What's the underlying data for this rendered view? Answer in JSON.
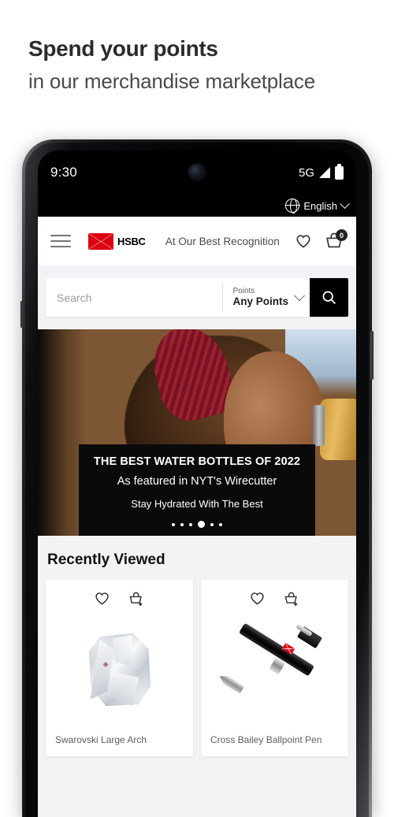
{
  "promo": {
    "title": "Spend your points",
    "subtitle": "in our merchandise marketplace"
  },
  "phone": {
    "statusbar": {
      "time": "9:30",
      "network": "5G",
      "signal_icon": "signal-bars-icon",
      "battery_icon": "battery-full-icon",
      "camera_icon": "front-camera-punch-hole"
    },
    "language_bar": {
      "globe_icon": "globe-icon",
      "label": "English",
      "chevron_icon": "chevron-down-icon"
    }
  },
  "navbar": {
    "menu_icon": "hamburger-menu-icon",
    "logo_text": "HSBC",
    "logo_icon": "hsbc-hexagon-logo",
    "brand_color": "#db0011",
    "title": "At Our Best Recognition",
    "wishlist_icon": "heart-icon",
    "cart_icon": "basket-icon",
    "cart_count": "0"
  },
  "search": {
    "placeholder": "Search",
    "value": "",
    "filter_label": "Points",
    "filter_value": "Any Points",
    "filter_chevron_icon": "chevron-down-icon",
    "submit_icon": "search-icon"
  },
  "hero": {
    "image_alt": "woman-drinking-from-water-bottle",
    "headline": "THE BEST WATER BOTTLES OF 2022",
    "subhead": "As featured in NYT's Wirecutter",
    "tagline": "Stay Hydrated With The Best",
    "carousel": {
      "total": 6,
      "active_index": 3
    }
  },
  "recently_viewed": {
    "title": "Recently Viewed",
    "products": [
      {
        "name": "Swarovski Large Arch",
        "image_alt": "crystal-arch-award",
        "wishlist_icon": "heart-icon",
        "add_icon": "add-to-basket-icon"
      },
      {
        "name": "Cross Bailey Ballpoint Pen",
        "image_alt": "black-ballpoint-pen",
        "wishlist_icon": "heart-icon",
        "add_icon": "add-to-basket-icon"
      }
    ]
  }
}
